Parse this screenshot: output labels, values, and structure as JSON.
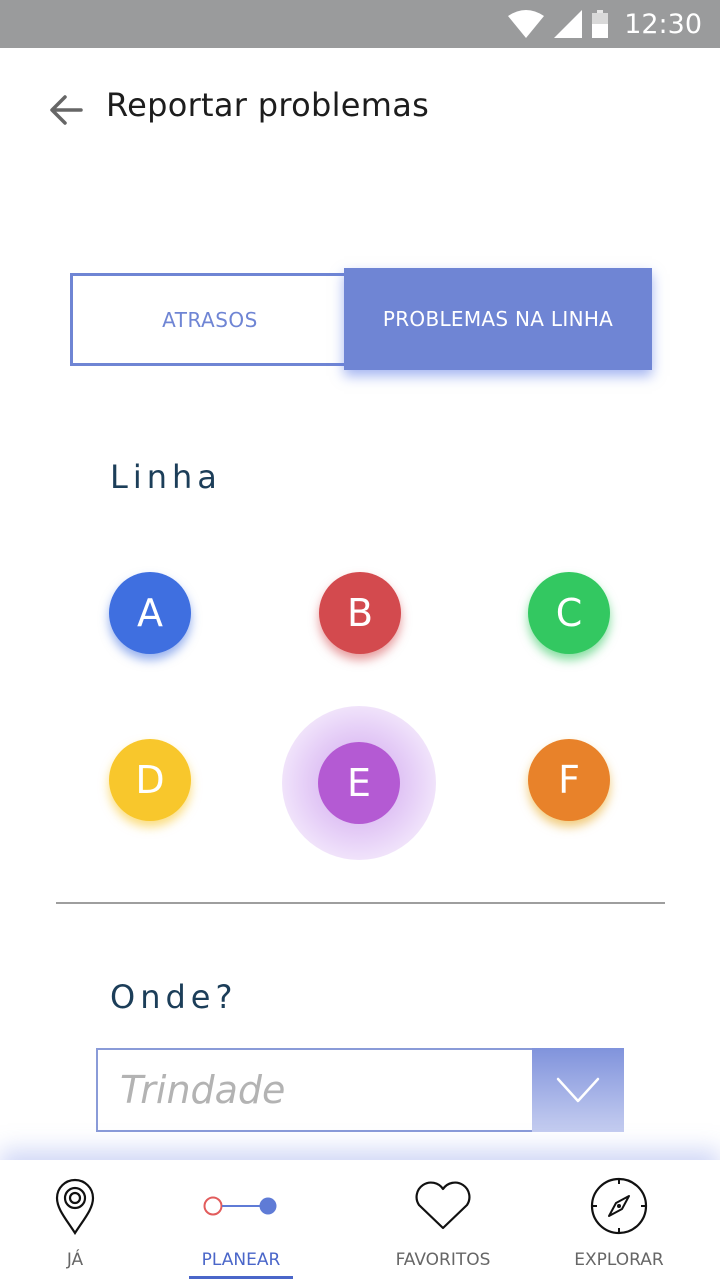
{
  "status_bar": {
    "time": "12:30"
  },
  "header": {
    "title": "Reportar problemas"
  },
  "tabs": [
    {
      "label": "ATRASOS",
      "active": false
    },
    {
      "label": "PROBLEMAS NA LINHA",
      "active": true
    }
  ],
  "section_line": {
    "heading": "Linha",
    "lines": [
      {
        "label": "A",
        "color": "#3f6fe0"
      },
      {
        "label": "B",
        "color": "#d34a4e"
      },
      {
        "label": "C",
        "color": "#33c861"
      },
      {
        "label": "D",
        "color": "#f8c72c"
      },
      {
        "label": "E",
        "color": "#b45ad3",
        "selected": true
      },
      {
        "label": "F",
        "color": "#e8822a"
      }
    ]
  },
  "section_where": {
    "heading": "Onde?",
    "select_value": "Trindade"
  },
  "bottom_nav": {
    "items": [
      {
        "label": "JÁ",
        "icon": "location-pin-icon",
        "active": false
      },
      {
        "label": "PLANEAR",
        "icon": "route-icon",
        "active": true
      },
      {
        "label": "FAVORITOS",
        "icon": "heart-icon",
        "active": false
      },
      {
        "label": "EXPLORAR",
        "icon": "compass-icon",
        "active": false
      }
    ]
  },
  "colors": {
    "accent": "#6f85d4",
    "heading": "#1c3e59",
    "active_nav": "#4a66c9"
  }
}
